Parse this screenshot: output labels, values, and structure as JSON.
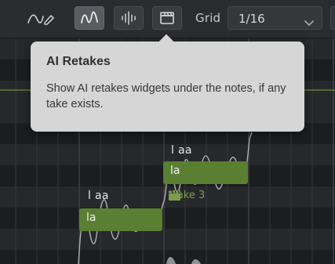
{
  "toolbar": {
    "tools": [
      {
        "name": "curve-pencil-tool",
        "icon": "curve-pencil-icon"
      },
      {
        "name": "pitch-curve-tool",
        "icon": "wave-curve-icon",
        "active": true
      },
      {
        "name": "audio-wave-tool",
        "icon": "waveform-icon"
      },
      {
        "name": "ai-retakes-tool",
        "icon": "clapperboard-icon"
      }
    ],
    "grid_label": "Grid",
    "grid_value": "1/16"
  },
  "tooltip": {
    "title": "AI Retakes",
    "body": "Show AI retakes widgets under the notes, if any take exists."
  },
  "notes": [
    {
      "text": "la",
      "lyric": "l aa"
    },
    {
      "text": "la",
      "lyric": "l aa"
    }
  ],
  "take_chip": {
    "label": "Take 3",
    "icon": "clapperboard-icon"
  },
  "colors": {
    "note_fill": "#5a7f33",
    "take_label": "#7e9c4e",
    "tooltip_bg": "#d6d6d6",
    "timeline_marker": "#7fa84a"
  }
}
